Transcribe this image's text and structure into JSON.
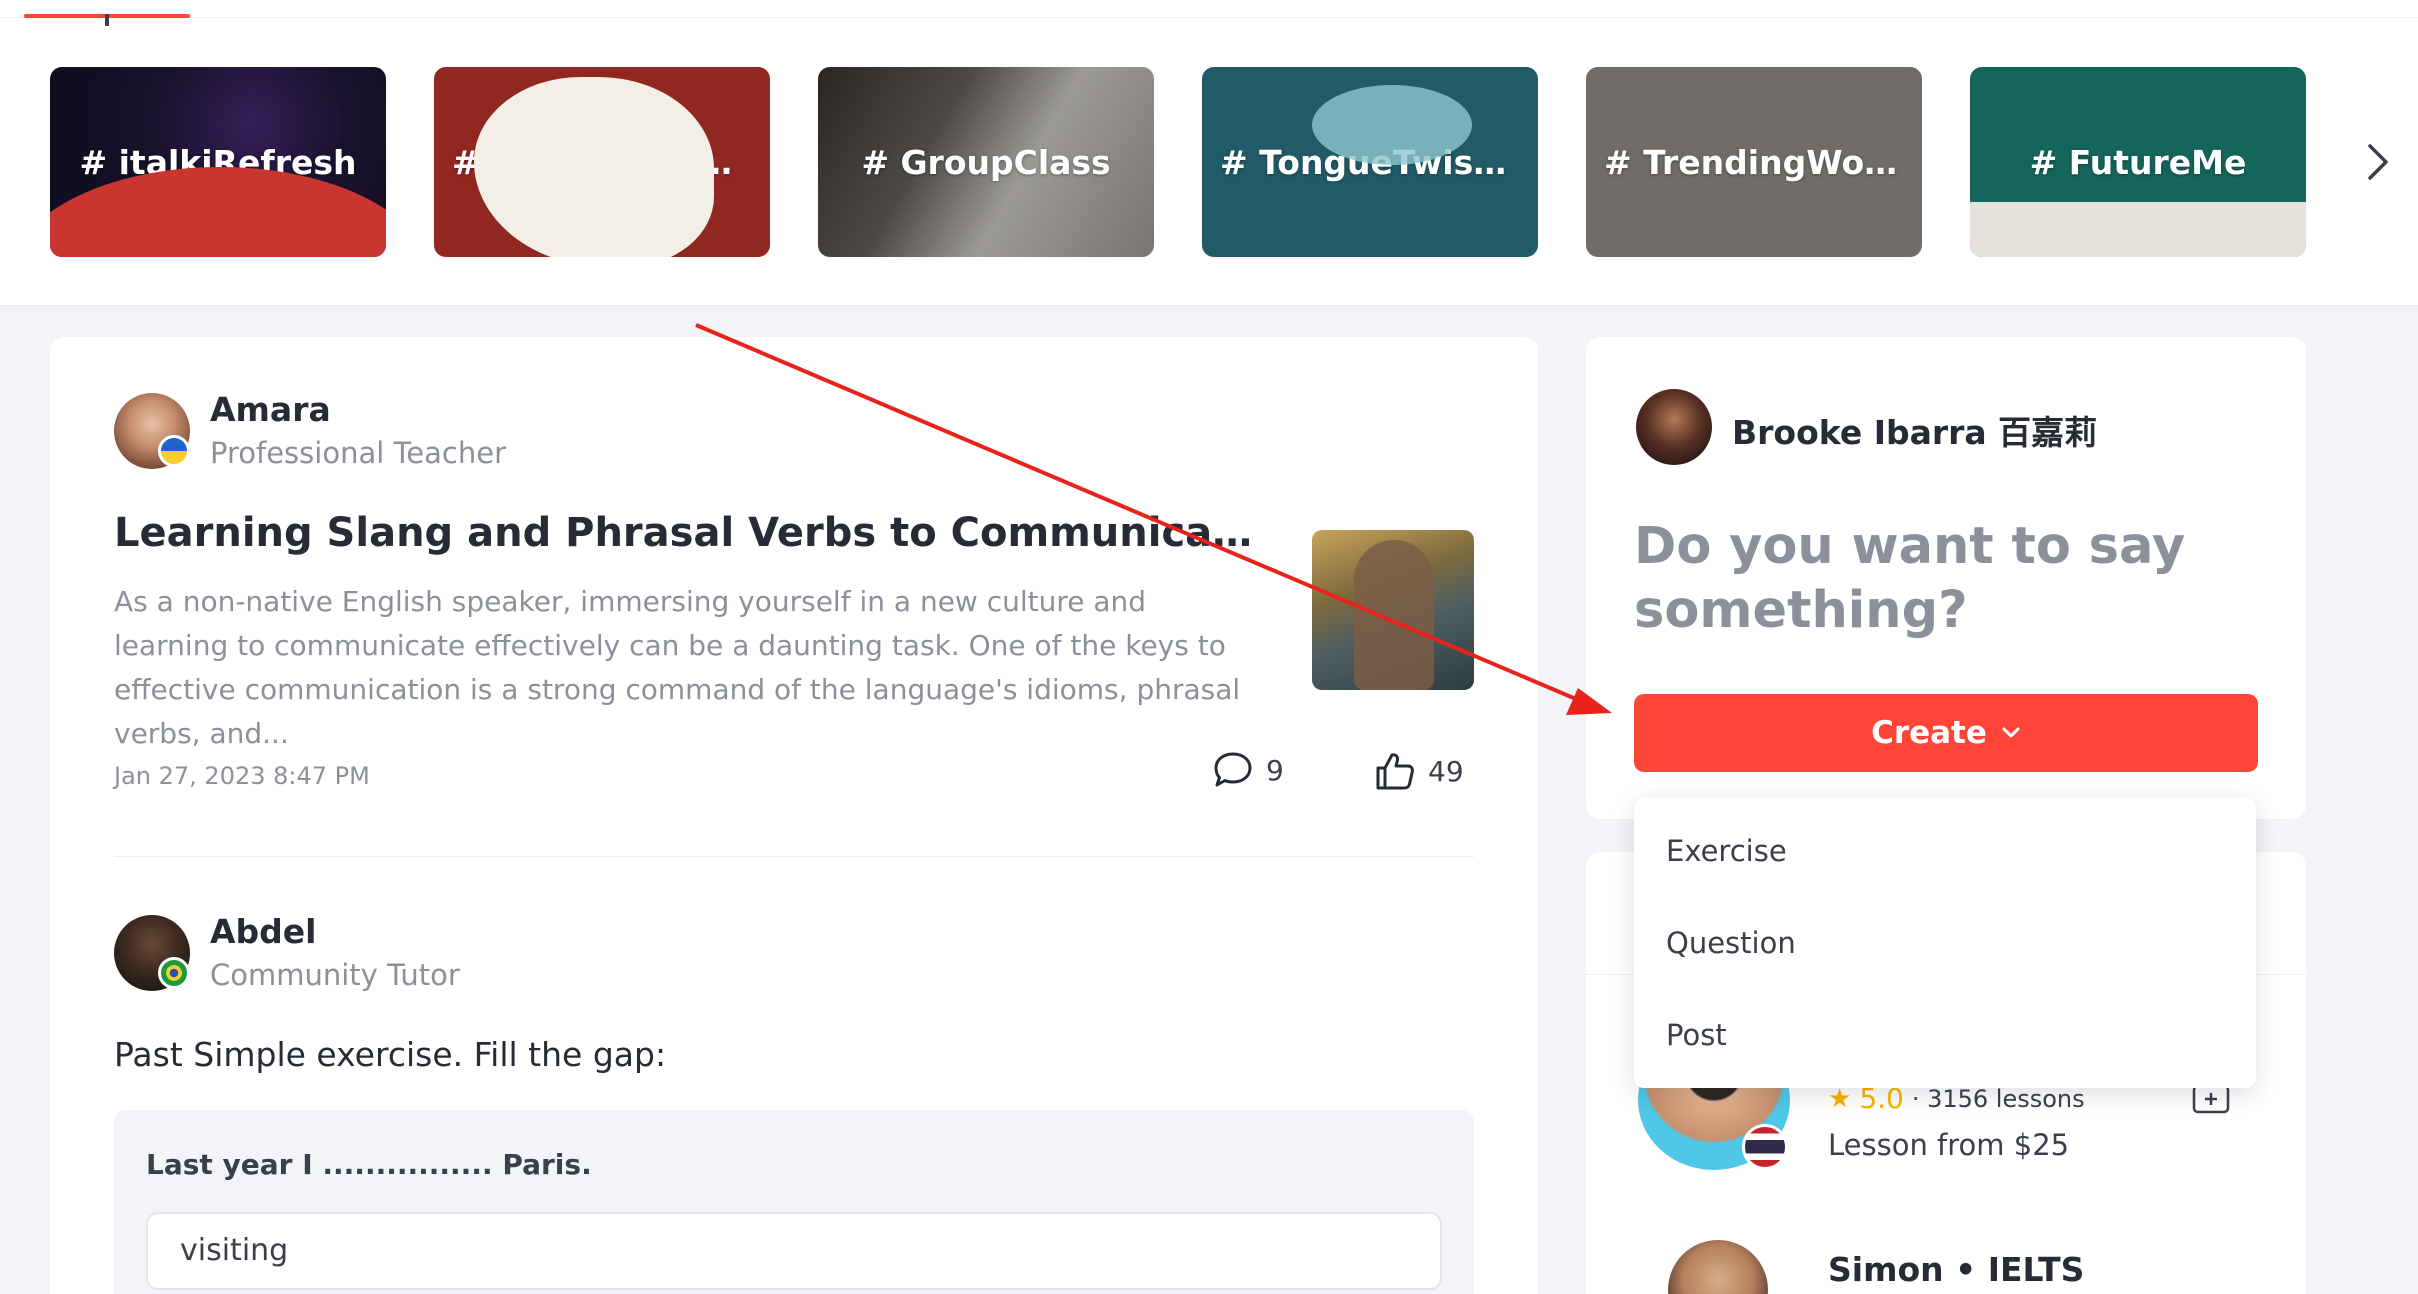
{
  "topics": {
    "items": [
      {
        "label": "# italkiRefresh"
      },
      {
        "label": "# italkiLanguageC..."
      },
      {
        "label": "# GroupClass"
      },
      {
        "label": "# TongueTwister"
      },
      {
        "label": "# TrendingWords"
      },
      {
        "label": "# FutureMe"
      }
    ],
    "next_icon": "chevron-right-icon"
  },
  "feed": {
    "post": {
      "author": "Amara",
      "role": "Professional Teacher",
      "title": "Learning Slang and Phrasal Verbs to Communicate With...",
      "excerpt": "As a non-native English speaker, immersing yourself in a new culture and learning to communicate effectively can be a daunting task. One of the keys to effective communication is a strong command of the language's idioms, phrasal verbs, and...",
      "date": "Jan 27, 2023 8:47 PM",
      "comments": "9",
      "likes": "49"
    },
    "exercise": {
      "author": "Abdel",
      "role": "Community Tutor",
      "text": "Past Simple exercise. Fill the gap:",
      "question": "Last year I ................ Paris.",
      "option": "visiting"
    }
  },
  "composer": {
    "user_name": "Brooke Ibarra 百嘉莉",
    "prompt": "Do you want to say something?",
    "create_label": "Create",
    "menu": [
      "Exercise",
      "Question",
      "Post"
    ]
  },
  "tutors": {
    "first": {
      "rating": "5.0",
      "lessons": "· 3156 lessons",
      "price": "Lesson from $25"
    },
    "second": {
      "name": "Simon • IELTS"
    }
  },
  "colors": {
    "accent": "#ff4438",
    "rating": "#f5b400",
    "muted": "#8c909a",
    "text": "#262b36"
  }
}
